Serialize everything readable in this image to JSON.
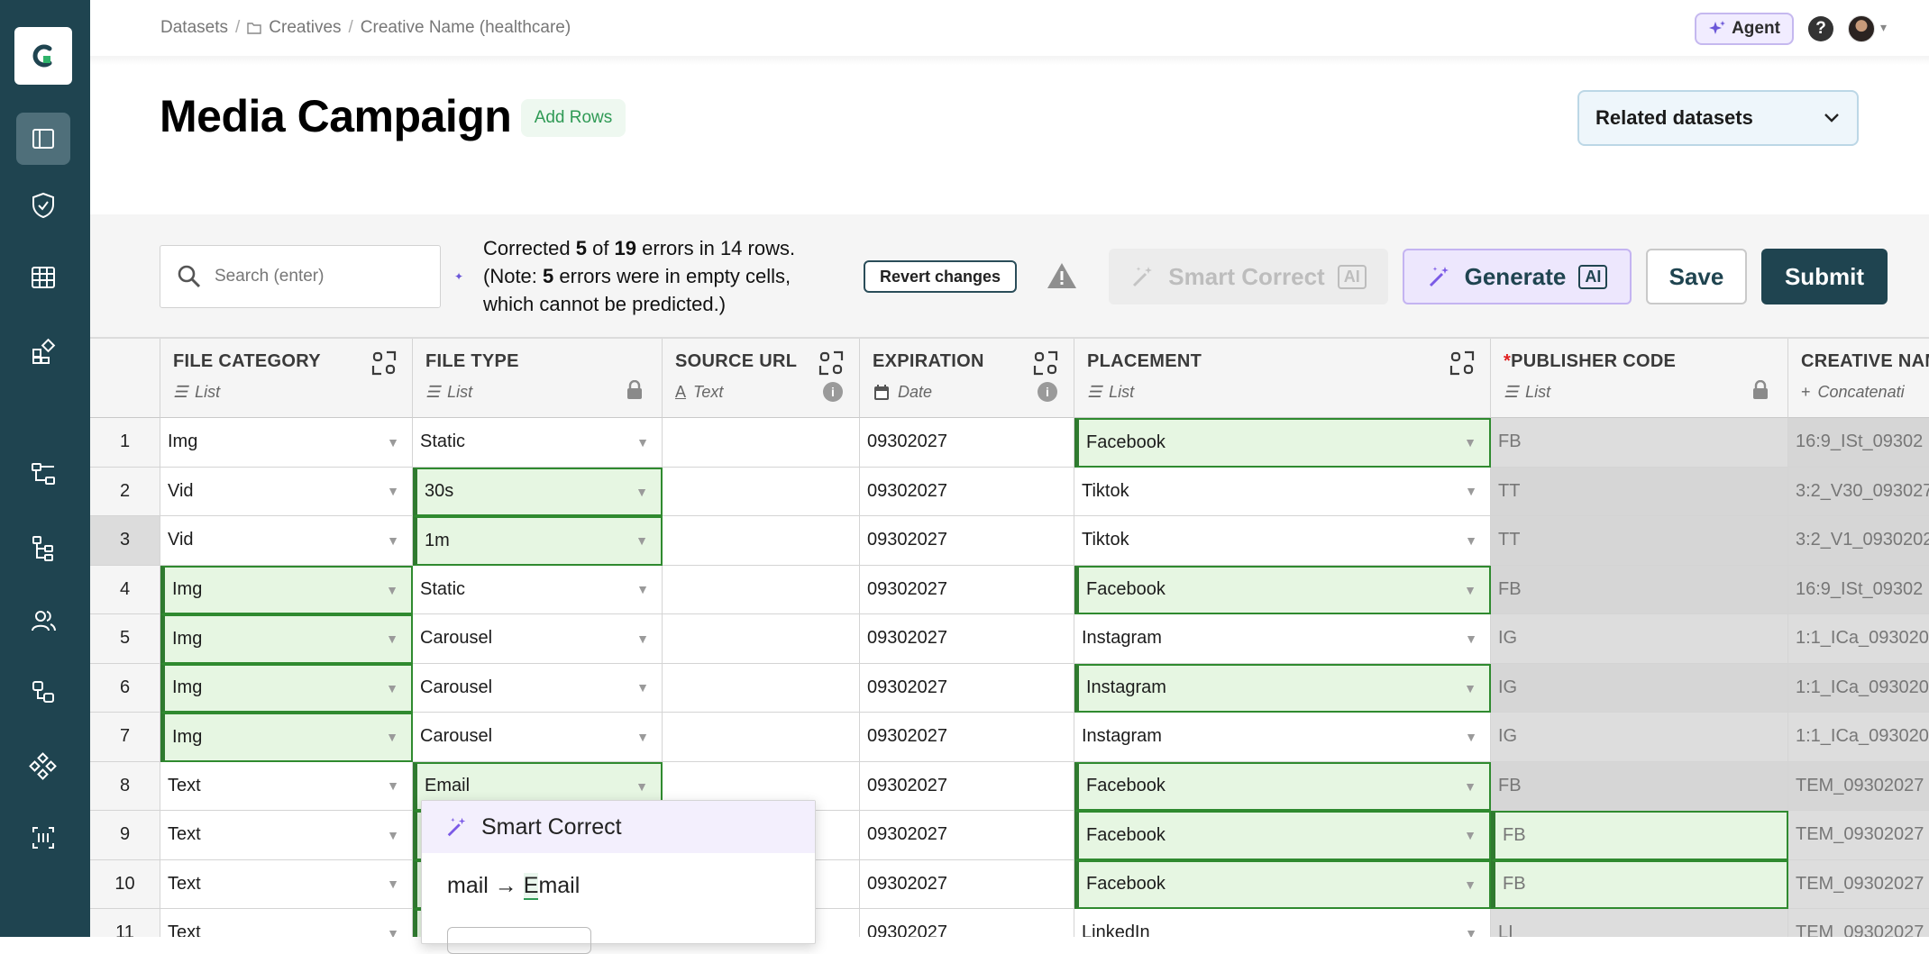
{
  "breadcrumb": {
    "root": "Datasets",
    "sep": "/",
    "folder": "Creatives",
    "current": "Creative Name (healthcare)"
  },
  "header": {
    "agent_label": "Agent",
    "help": "?"
  },
  "page": {
    "title": "Media Campaign",
    "add_rows": "Add Rows",
    "related": "Related datasets"
  },
  "toolbar": {
    "search_placeholder": "Search (enter)",
    "status": {
      "p1": "Corrected ",
      "corrected": "5",
      "p2": " of ",
      "total": "19",
      "p3": " errors in 14 rows.",
      "p4": "(Note: ",
      "empty": "5",
      "p5": " errors were in empty cells, which cannot be predicted.)"
    },
    "revert": "Revert changes",
    "smart_correct": "Smart Correct",
    "generate": "Generate",
    "ai": "AI",
    "save": "Save",
    "submit": "Submit"
  },
  "columns": [
    {
      "name": "FILE CATEGORY",
      "type": "List"
    },
    {
      "name": "FILE TYPE",
      "type": "List"
    },
    {
      "name": "SOURCE URL",
      "type": "Text"
    },
    {
      "name": "EXPIRATION",
      "type": "Date"
    },
    {
      "name": "PLACEMENT",
      "type": "List"
    },
    {
      "name": "PUBLISHER CODE",
      "type": "List",
      "required": "*"
    },
    {
      "name": "CREATIVE NAM",
      "type": "Concatenati"
    }
  ],
  "rows": [
    {
      "n": "1",
      "cat": "Img",
      "ftype": "Static",
      "url": "",
      "exp": "09302027",
      "place": "Facebook",
      "pub": "FB",
      "cname": "16:9_ISt_09302"
    },
    {
      "n": "2",
      "cat": "Vid",
      "ftype": "30s",
      "url": "",
      "exp": "09302027",
      "place": "Tiktok",
      "pub": "TT",
      "cname": "3:2_V30_093027"
    },
    {
      "n": "3",
      "cat": "Vid",
      "ftype": "1m",
      "url": "",
      "exp": "09302027",
      "place": "Tiktok",
      "pub": "TT",
      "cname": "3:2_V1_0930202"
    },
    {
      "n": "4",
      "cat": "Img",
      "ftype": "Static",
      "url": "",
      "exp": "09302027",
      "place": "Facebook",
      "pub": "FB",
      "cname": "16:9_ISt_09302"
    },
    {
      "n": "5",
      "cat": "Img",
      "ftype": "Carousel",
      "url": "",
      "exp": "09302027",
      "place": "Instagram",
      "pub": "IG",
      "cname": "1:1_ICa_093020"
    },
    {
      "n": "6",
      "cat": "Img",
      "ftype": "Carousel",
      "url": "",
      "exp": "09302027",
      "place": "Instagram",
      "pub": "IG",
      "cname": "1:1_ICa_093020"
    },
    {
      "n": "7",
      "cat": "Img",
      "ftype": "Carousel",
      "url": "",
      "exp": "09302027",
      "place": "Instagram",
      "pub": "IG",
      "cname": "1:1_ICa_093020"
    },
    {
      "n": "8",
      "cat": "Text",
      "ftype": "Email",
      "url": "",
      "exp": "09302027",
      "place": "Facebook",
      "pub": "FB",
      "cname": "TEM_09302027"
    },
    {
      "n": "9",
      "cat": "Text",
      "ftype": "",
      "url": "",
      "exp": "09302027",
      "place": "Facebook",
      "pub": "FB",
      "cname": "TEM_09302027"
    },
    {
      "n": "10",
      "cat": "Text",
      "ftype": "",
      "url": "",
      "exp": "09302027",
      "place": "Facebook",
      "pub": "FB",
      "cname": "TEM_09302027"
    },
    {
      "n": "11",
      "cat": "Text",
      "ftype": "",
      "url": "",
      "exp": "09302027",
      "place": "LinkedIn",
      "pub": "LI",
      "cname": "TEM_09302027"
    }
  ],
  "popover": {
    "title": "Smart Correct",
    "from": "mail",
    "arrow": " → ",
    "to_first": "E",
    "to_rest": "mail"
  },
  "colors": {
    "sidebar": "#1f4450",
    "success_bg": "#e6f6e2",
    "success_border": "#2f8a2f",
    "accent_purple": "#6b57d8",
    "primary": "#1f4450"
  }
}
